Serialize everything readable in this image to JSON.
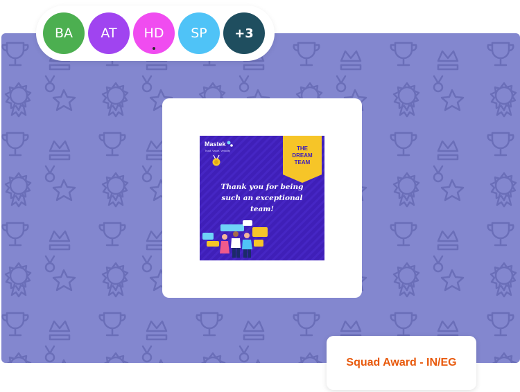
{
  "avatars": [
    {
      "initials": "BA",
      "color": "#4caf50"
    },
    {
      "initials": "AT",
      "color": "#a044f0"
    },
    {
      "initials": "HD",
      "color": "#f04cf0"
    },
    {
      "initials": "SP",
      "color": "#4fc3f7"
    }
  ],
  "more_badge": {
    "label": "+3",
    "color": "#1f4e5f"
  },
  "award": {
    "title": "Squad Award - IN/EG",
    "poster": {
      "brand": "Mastek",
      "tagline": "Trust. Value. Velocity",
      "ribbon_line1": "THE",
      "ribbon_line2": "DREAM",
      "ribbon_line3": "TEAM",
      "message_line1": "Thank you for being",
      "message_line2": "such an exceptional",
      "message_line3": "team!"
    }
  },
  "colors": {
    "banner": "#8387cf",
    "poster_bg": "#3f1fb8",
    "ribbon": "#f6c528",
    "title": "#e8590c"
  }
}
